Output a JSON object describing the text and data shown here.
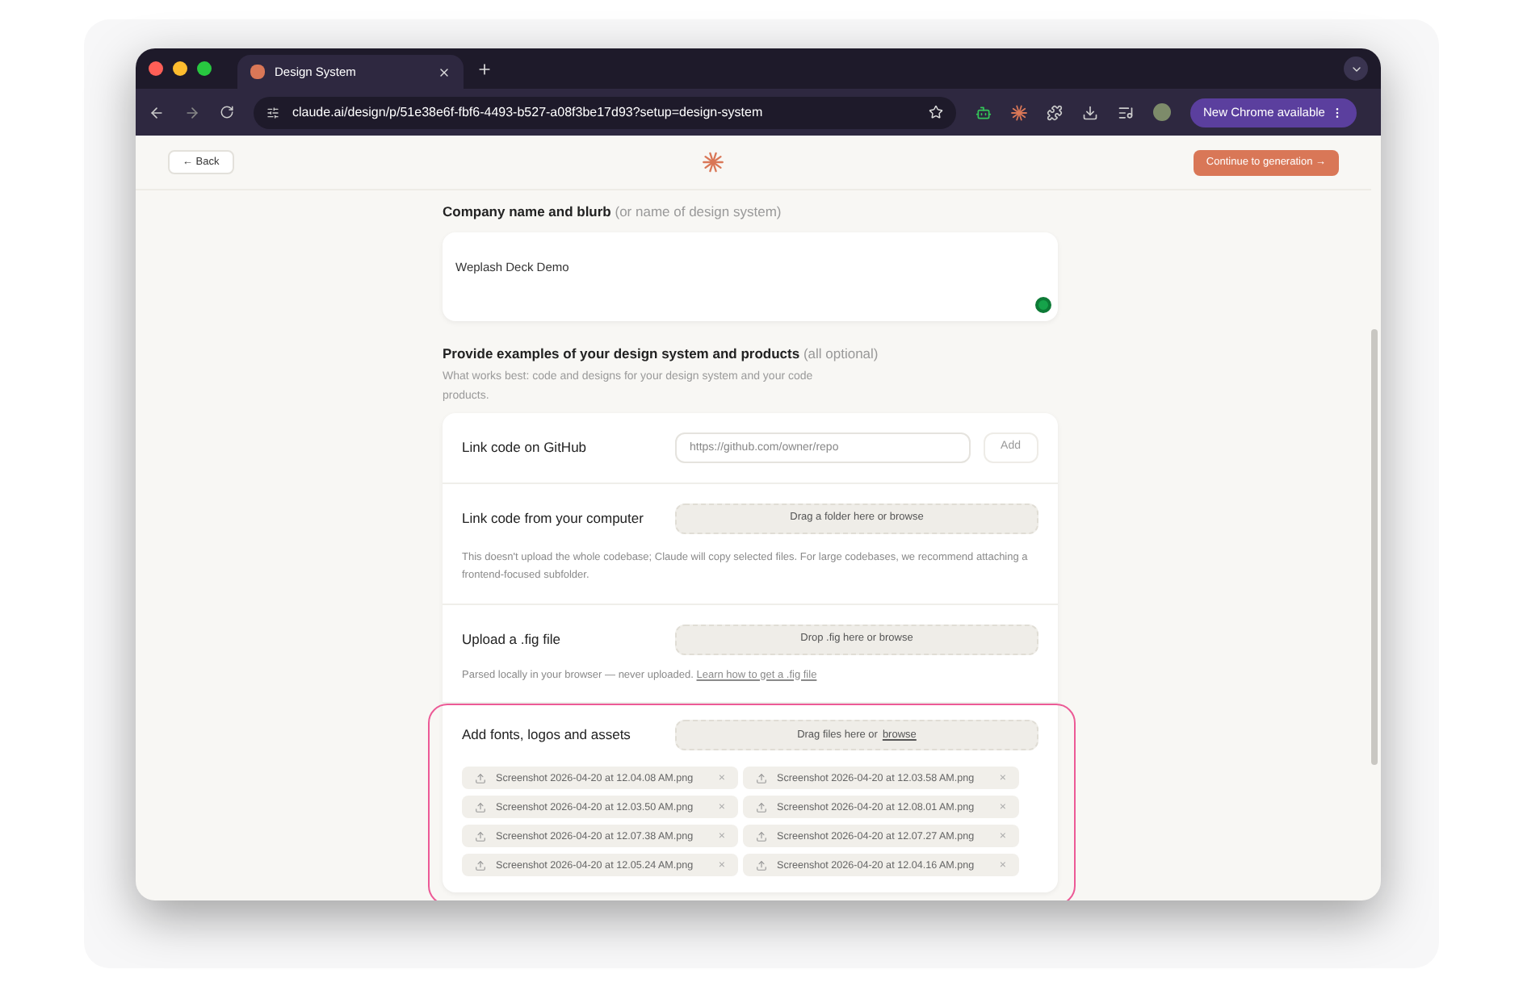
{
  "browser": {
    "tab_title": "Design System",
    "url": "claude.ai/design/p/51e38e6f-fbf6-4493-b527-a08f3be17d93?setup=design-system",
    "update_button": "New Chrome available"
  },
  "header": {
    "back_button": "← Back",
    "continue_button": "Continue to generation →"
  },
  "company": {
    "label": "Company name and blurb",
    "hint": "(or name of design system)",
    "value": "Weplash Deck Demo"
  },
  "examples": {
    "title": "Provide examples of your design system and products",
    "hint": "(all optional)",
    "description": "What works best: code and designs for your design system and your code products."
  },
  "github": {
    "label": "Link code on GitHub",
    "placeholder": "https://github.com/owner/repo",
    "button": "Add"
  },
  "computer": {
    "label": "Link code from your computer",
    "dropzone": "Drag a folder here or browse",
    "note": "This doesn't upload the whole codebase; Claude will copy selected files. For large codebases, we recommend attaching a frontend-focused subfolder."
  },
  "fig": {
    "label": "Upload a .fig file",
    "dropzone": "Drop .fig here or browse",
    "note": "Parsed locally in your browser — never uploaded.",
    "link": "Learn how to get a .fig file"
  },
  "assets": {
    "label": "Add fonts, logos and assets",
    "dropzone_text": "Drag files here or",
    "dropzone_link": "browse",
    "highlighted": true,
    "files": [
      {
        "name": "Screenshot 2026-04-20 at 12.04.08 AM.png",
        "remove": "×"
      },
      {
        "name": "Screenshot 2026-04-20 at 12.03.58 AM.png",
        "remove": "×"
      },
      {
        "name": "Screenshot 2026-04-20 at 12.03.50 AM.png",
        "remove": "×"
      },
      {
        "name": "Screenshot 2026-04-20 at 12.08.01 AM.png",
        "remove": "×"
      },
      {
        "name": "Screenshot 2026-04-20 at 12.07.38 AM.png",
        "remove": "×"
      },
      {
        "name": "Screenshot 2026-04-20 at 12.07.27 AM.png",
        "remove": "×"
      },
      {
        "name": "Screenshot 2026-04-20 at 12.05.24 AM.png",
        "remove": "×"
      },
      {
        "name": "Screenshot 2026-04-20 at 12.04.16 AM.png",
        "remove": "×"
      }
    ]
  }
}
